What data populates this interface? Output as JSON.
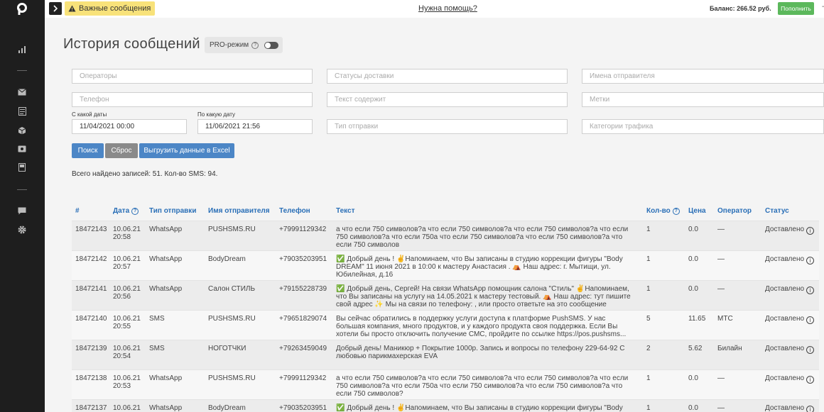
{
  "topbar": {
    "important_label": "Важные сообщения",
    "help_link": "Нужна помощь?",
    "balance": "Баланс: 266.52 руб.",
    "topup_label": "Пополнить",
    "extra": "-"
  },
  "page": {
    "title": "История сообщений",
    "pro_label": "PRO-режим"
  },
  "filters": {
    "operators_ph": "Операторы",
    "statuses_ph": "Статусы доставки",
    "senders_ph": "Имена отправителя",
    "phone_ph": "Телефон",
    "text_ph": "Текст содержит",
    "tags_ph": "Метки",
    "from_label": "С какой даты",
    "from_value": "11/04/2021 00:00",
    "to_label": "По какую дату",
    "to_value": "11/06/2021 21:56",
    "send_type_ph": "Тип отправки",
    "traffic_ph": "Категории трафика"
  },
  "buttons": {
    "search": "Поиск",
    "reset": "Сброс",
    "export": "Выгрузить данные в Excel"
  },
  "summary": "Всего найдено записей: 51. Кол-во SMS: 94.",
  "table": {
    "headers": {
      "id": "#",
      "date": "Дата",
      "type": "Тип отправки",
      "sender": "Имя отправителя",
      "phone": "Телефон",
      "text": "Текст",
      "count": "Кол-во",
      "price": "Цена",
      "operator": "Оператор",
      "status": "Статус"
    },
    "rows": [
      {
        "id": "18472143",
        "date": "10.06.21",
        "time": "20:58",
        "type": "WhatsApp",
        "sender": "PUSHSMS.RU",
        "phone": "+79991129342",
        "t1": "а что если 750 символов?а что если 750 символов?а что если 750 символов?а что если",
        "t2": "750 символов?а что если 750а что если 750 символов?а что если 750 символов?а что",
        "t3": "если 750 символов",
        "count": "1",
        "price": "0.0",
        "operator": "—",
        "status": "Доставлено"
      },
      {
        "id": "18472142",
        "date": "10.06.21",
        "time": "20:57",
        "type": "WhatsApp",
        "sender": "BodyDream",
        "phone": "+79035203951",
        "t1": "✅ Добрый день ! ✌Напоминаем, что Вы записаны в студию коррекции фигуры \"Body",
        "t2": "DREAM\" 11 июня 2021 в 10:00 к мастеру Анастасия . ⛺ Наш адрес: г. Мытищи, ул.",
        "t3": "Юбилейная, д.16",
        "count": "1",
        "price": "0.0",
        "operator": "—",
        "status": "Доставлено"
      },
      {
        "id": "18472141",
        "date": "10.06.21",
        "time": "20:56",
        "type": "WhatsApp",
        "sender": "Салон СТИЛЬ",
        "phone": "+79155228739",
        "t1": "✅ Добрый день, Сергей! На связи WhatsApp помощник салона \"Стиль\" ✌Напоминаем,",
        "t2": "что Вы записаны на услугу на 14.05.2021 к мастеру тестовый. ⛺ Наш адрес: тут пишите",
        "t3": "свой адрес ✨ Мы на связи по телефону: , или просто ответьте на это сообщение",
        "count": "1",
        "price": "0.0",
        "operator": "—",
        "status": "Доставлено"
      },
      {
        "id": "18472140",
        "date": "10.06.21",
        "time": "20:55",
        "type": "SMS",
        "sender": "PUSHSMS.RU",
        "phone": "+79651829074",
        "t1": "Вы сейчас обратились в поддержку услуги доступа к платформе PushSMS. У нас",
        "t2": "большая компания, много продуктов, и у каждого продукта своя поддержка. Если Вы",
        "t3": "хотели бы просто отключить получение СМС, пройдите по ссылке https://pos.pushsms...",
        "count": "5",
        "price": "11.65",
        "operator": "МТС",
        "status": "Доставлено"
      },
      {
        "id": "18472139",
        "date": "10.06.21",
        "time": "20:54",
        "type": "SMS",
        "sender": "НОГОТЧКИ",
        "phone": "+79263459049",
        "t1": "Добрый день! Маникюр + Покрытие 1000р. Запись и вопросы по телефону 229-64-92 С",
        "t2": "любовью парикмахерская EVA",
        "t3": "",
        "count": "2",
        "price": "5.62",
        "operator": "Билайн",
        "status": "Доставлено"
      },
      {
        "id": "18472138",
        "date": "10.06.21",
        "time": "20:53",
        "type": "WhatsApp",
        "sender": "PUSHSMS.RU",
        "phone": "+79991129342",
        "t1": "а что если 750 символов?а что если 750 символов?а что если 750 символов?а что если",
        "t2": "750 символов?а что если 750а что если 750 символов?а что если 750 символов?а что",
        "t3": "если 750 символов?",
        "count": "1",
        "price": "0.0",
        "operator": "—",
        "status": "Доставлено"
      },
      {
        "id": "18472137",
        "date": "10.06.21",
        "time": "",
        "type": "WhatsApp",
        "sender": "BodyDream",
        "phone": "+79035203951",
        "t1": "✅ Добрый день ! ✌Напоминаем, что Вы записаны в студию коррекции фигуры \"Body",
        "t2": "",
        "t3": "",
        "count": "1",
        "price": "0.0",
        "operator": "—",
        "status": "Доставлено"
      }
    ]
  }
}
